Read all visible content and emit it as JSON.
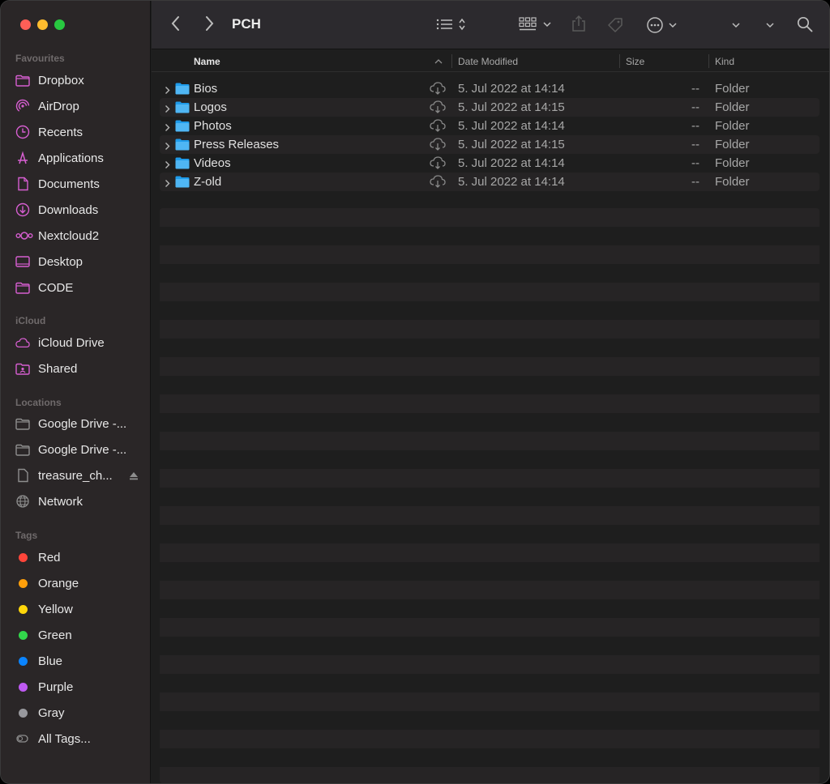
{
  "window": {
    "title": "PCH"
  },
  "sidebar": {
    "sections": {
      "favourites": "Favourites",
      "icloud": "iCloud",
      "locations": "Locations",
      "tags": "Tags"
    },
    "favourites": [
      {
        "label": "Dropbox",
        "icon": "folder-icon"
      },
      {
        "label": "AirDrop",
        "icon": "airdrop-icon"
      },
      {
        "label": "Recents",
        "icon": "clock-icon"
      },
      {
        "label": "Applications",
        "icon": "applications-icon"
      },
      {
        "label": "Documents",
        "icon": "document-icon"
      },
      {
        "label": "Downloads",
        "icon": "download-icon"
      },
      {
        "label": "Nextcloud2",
        "icon": "nextcloud-icon"
      },
      {
        "label": "Desktop",
        "icon": "desktop-icon"
      },
      {
        "label": "CODE",
        "icon": "folder-icon"
      }
    ],
    "icloud": [
      {
        "label": "iCloud Drive",
        "icon": "cloud-icon"
      },
      {
        "label": "Shared",
        "icon": "shared-folder-icon"
      }
    ],
    "locations": [
      {
        "label": "Google Drive -...",
        "icon": "folder-icon"
      },
      {
        "label": "Google Drive -...",
        "icon": "folder-icon"
      },
      {
        "label": "treasure_ch...",
        "icon": "drive-icon"
      },
      {
        "label": "Network",
        "icon": "globe-icon"
      }
    ],
    "tags": [
      {
        "label": "Red",
        "color": "#ff453a"
      },
      {
        "label": "Orange",
        "color": "#ff9f0a"
      },
      {
        "label": "Yellow",
        "color": "#ffd60a"
      },
      {
        "label": "Green",
        "color": "#32d74b"
      },
      {
        "label": "Blue",
        "color": "#0a84ff"
      },
      {
        "label": "Purple",
        "color": "#bf5af2"
      },
      {
        "label": "Gray",
        "color": "#98989d"
      },
      {
        "label": "All Tags...",
        "color": ""
      }
    ],
    "accent_color": "#d65ed0"
  },
  "columns": {
    "name": "Name",
    "date": "Date Modified",
    "size": "Size",
    "kind": "Kind"
  },
  "files": [
    {
      "name": "Bios",
      "date": "5. Jul 2022 at 14:14",
      "size": "--",
      "kind": "Folder"
    },
    {
      "name": "Logos",
      "date": "5. Jul 2022 at 14:15",
      "size": "--",
      "kind": "Folder"
    },
    {
      "name": "Photos",
      "date": "5. Jul 2022 at 14:14",
      "size": "--",
      "kind": "Folder"
    },
    {
      "name": "Press Releases",
      "date": "5. Jul 2022 at 14:15",
      "size": "--",
      "kind": "Folder"
    },
    {
      "name": "Videos",
      "date": "5. Jul 2022 at 14:14",
      "size": "--",
      "kind": "Folder"
    },
    {
      "name": "Z-old",
      "date": "5. Jul 2022 at 14:14",
      "size": "--",
      "kind": "Folder"
    }
  ]
}
